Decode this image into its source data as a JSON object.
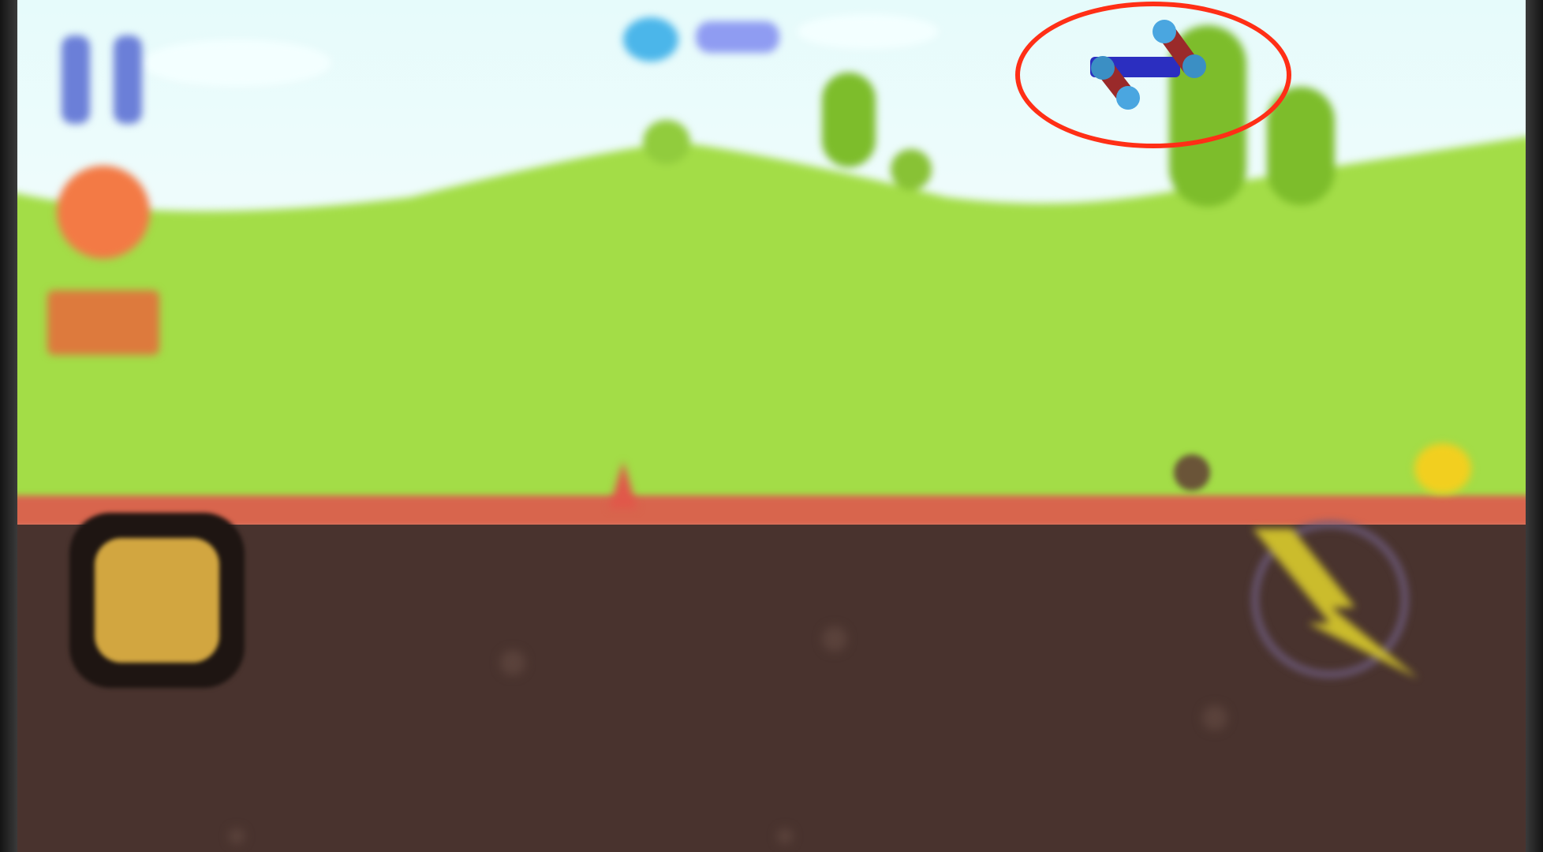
{
  "scene": {
    "colors": {
      "sky": "#e6fbfb",
      "hill_grass": "#a3dd47",
      "tree_green": "#7dbd2b",
      "ground_strip": "#d8654d",
      "dirt": "#49332e",
      "highlight_ring": "#ff2f16"
    }
  },
  "hud": {
    "pause_icon": "pause-icon",
    "pause_color": "#6b7fd8",
    "life_color": "#f37a45",
    "score_panel_text": "",
    "top_coin_icon": "coin-icon",
    "top_counter_text": ""
  },
  "controls": {
    "jump_icon": "square-button-icon",
    "jump_color": "#d2a640",
    "ability_icon": "lightning-icon",
    "ability_color": "#cbbc2c"
  },
  "player": {
    "icon": "stick-figure-icon",
    "body_color": "#2b2ec0",
    "limb_color": "#9a2a2a",
    "joint_color": "#4aa6e0"
  }
}
